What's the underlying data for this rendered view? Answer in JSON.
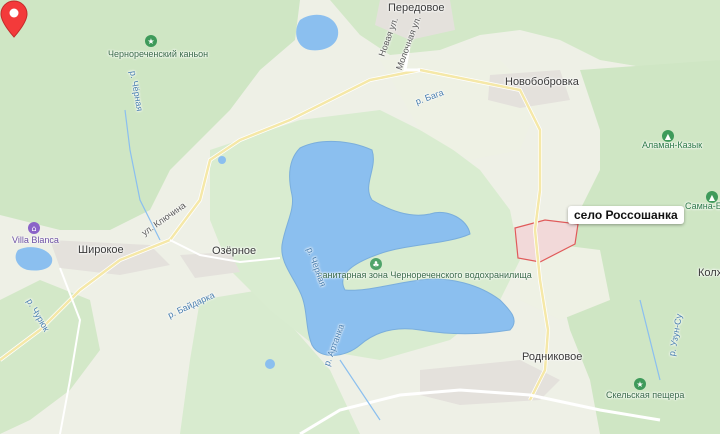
{
  "marker": {
    "label": "село Россошанка",
    "color": "#f33a3a",
    "icon": "map-pin-icon"
  },
  "settlements": [
    {
      "id": "peredovoe",
      "name": "Передовое"
    },
    {
      "id": "novobobrovka",
      "name": "Новобобровка"
    },
    {
      "id": "shirokoe",
      "name": "Широкое"
    },
    {
      "id": "ozernoe",
      "name": "Озёрное"
    },
    {
      "id": "rodnikovoe",
      "name": "Родниковое"
    },
    {
      "id": "kolkhoz",
      "name": "Колхо"
    }
  ],
  "natural": [
    {
      "id": "canyon",
      "name": "Чернореченский каньон"
    },
    {
      "id": "alaman",
      "name": "Аламан-Казык"
    },
    {
      "id": "samna",
      "name": "Самна-Ба"
    },
    {
      "id": "cave",
      "name": "Скельская пещера"
    }
  ],
  "center_label": "санитарная зона Чернореченского водохранилища",
  "hotel": "Villa Blanca",
  "rivers": [
    {
      "id": "baidarka",
      "name": "р. Байдарка"
    },
    {
      "id": "chernaya",
      "name": "р. Чёрная"
    },
    {
      "id": "chernaya2",
      "name": "р. Чёрная"
    },
    {
      "id": "artanka",
      "name": "р. Артанка"
    },
    {
      "id": "bayu",
      "name": "р. Бага"
    },
    {
      "id": "churyuk",
      "name": "р. Чурюк"
    },
    {
      "id": "uzun",
      "name": "р. Узун-Су"
    }
  ],
  "streets": [
    {
      "id": "klyuchina",
      "name": "ул. Ключина"
    },
    {
      "id": "novaya",
      "name": "Новая ул."
    },
    {
      "id": "molochnaya",
      "name": "Молочная ул."
    }
  ],
  "colors": {
    "forest": "#cfe6c4",
    "light_green": "#e3eed9",
    "water": "#8bbfef",
    "road": "#f5e8a8",
    "settlement": "#e4e1dc",
    "marker": "#f33a3a"
  }
}
